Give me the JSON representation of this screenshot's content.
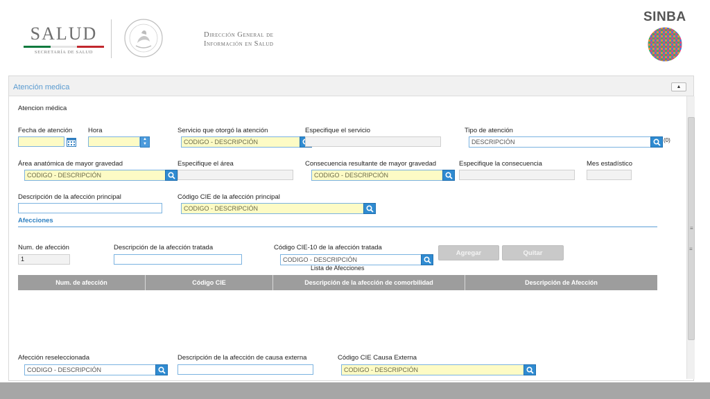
{
  "header": {
    "brand": "SALUD",
    "brand_sub": "SECRETARÍA DE SALUD",
    "brand_colors": [
      "#0f7a3e",
      "#ffffff",
      "#c1272d"
    ],
    "seal_icon": "mexico-coat-of-arms-seal",
    "dgis_line1": "Dirección General de",
    "dgis_line2": "Información en Salud",
    "sinba": "SINBA",
    "sinba_icon": "sinba-globe-logo"
  },
  "panel": {
    "title": "Atención medica",
    "collapse_icon": "caret-up-icon"
  },
  "form": {
    "section_heading": "Atencion médica",
    "fecha_label": "Fecha de atención",
    "fecha_value": "",
    "hora_label": "Hora",
    "hora_value": "",
    "servicio_label": "Servicio que otorgó la atención",
    "servicio_placeholder": "CODIGO - DESCRIPCIÓN",
    "especifique_servicio_label": "Especifique el servicio",
    "tipo_atencion_label": "Tipo de atención",
    "tipo_atencion_placeholder": "DESCRIPCIÓN",
    "tipo_atencion_count": "(0)",
    "area_label": "Área anatómica de mayor gravedad",
    "area_placeholder": "CODIGO - DESCRIPCIÓN",
    "especifique_area_label": "Especifique el área",
    "consecuencia_label": "Consecuencia resultante de mayor gravedad",
    "consecuencia_placeholder": "CODIGO - DESCRIPCIÓN",
    "especifique_consecuencia_label": "Especifique la consecuencia",
    "mes_label": "Mes estadístico",
    "descripcion_principal_label": "Descripción de la afección principal",
    "cie_principal_label": "Código CIE de la afección principal",
    "cie_principal_placeholder": "CODIGO - DESCRIPCIÓN"
  },
  "afecciones": {
    "title": "Afecciones",
    "num_label": "Num. de afección",
    "num_value": "1",
    "descripcion_label": "Descripción de la afección tratada",
    "cie10_label": "Código CIE-10 de la afección tratada",
    "cie10_placeholder": "CODIGO - DESCRIPCIÓN",
    "agregar": "Agregar",
    "quitar": "Quitar",
    "list_caption": "Lista de Afecciones",
    "columns": [
      "Num. de afección",
      "Código CIE",
      "Descripción de la afección de comorbilidad",
      "Descripción de Afección"
    ],
    "rows": []
  },
  "bottom": {
    "reseleccionada_label": "Afección reseleccionada",
    "reseleccionada_placeholder": "CODIGO - DESCRIPCIÓN",
    "causa_externa_label": "Descripción de la afección de causa externa",
    "cie_causa_label": "Código CIE Causa Externa",
    "cie_causa_placeholder": "CODIGO - DESCRIPCIÓN"
  }
}
